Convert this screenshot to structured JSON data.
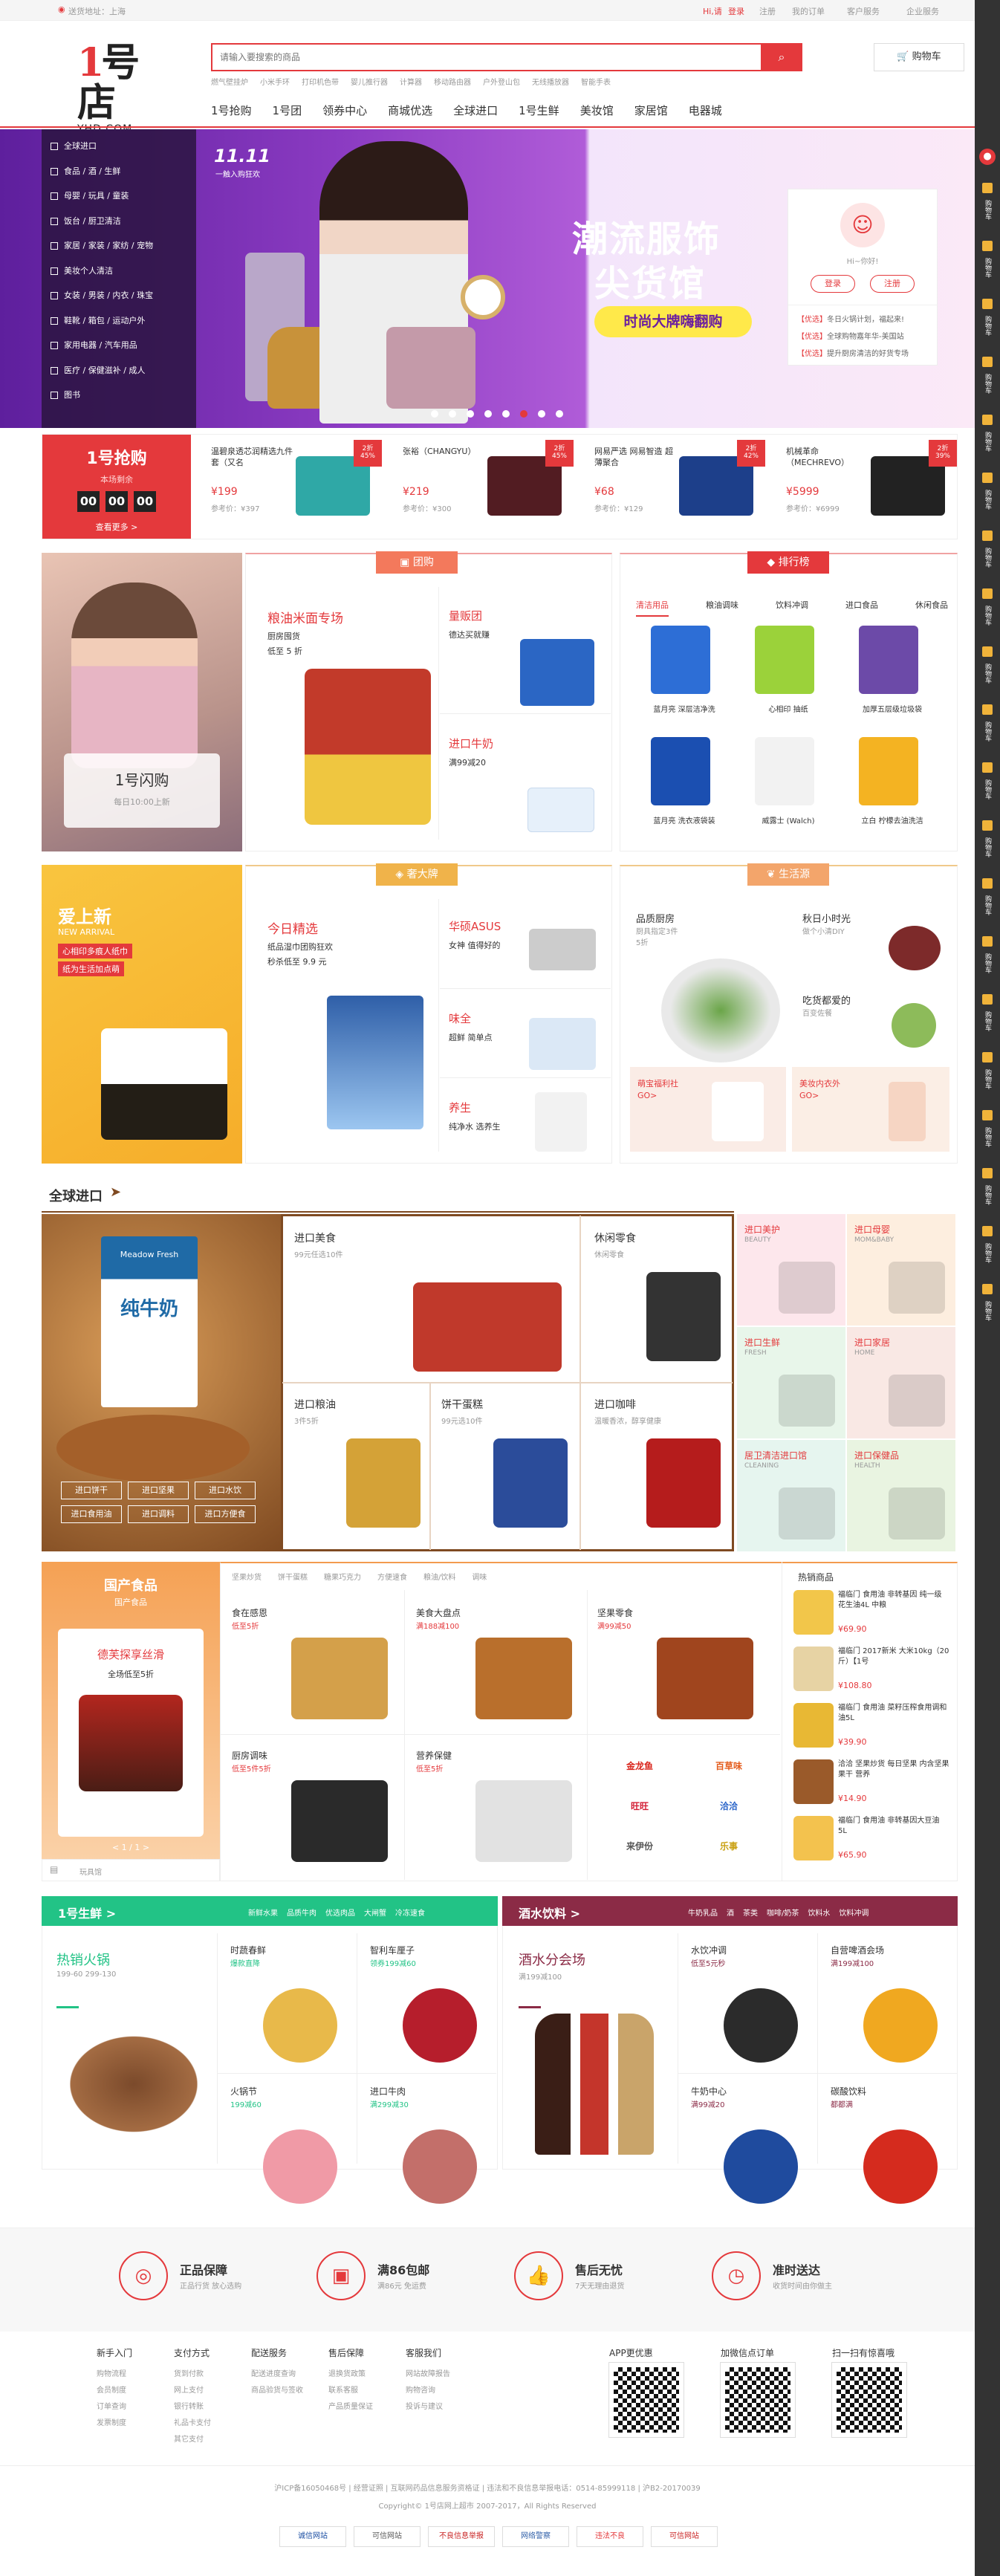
{
  "topbar": {
    "location": "送货地址：上海",
    "greeting": "Hi,请",
    "login": "登录",
    "register": "注册",
    "my_orders": "我的订单",
    "customer_service": "客户服务",
    "enterprise": "企业服务"
  },
  "logo": {
    "sub": "YHD.COM"
  },
  "search": {
    "placeholder": "请输入要搜索的商品",
    "hot": [
      "燃气壁挂炉",
      "小米手环",
      "打印机色带",
      "婴儿推行器",
      "计算器",
      "移动路由器",
      "户外登山包",
      "无线播放器",
      "智能手表"
    ],
    "cart": "购物车"
  },
  "nav": [
    "1号抢购",
    "1号团",
    "领券中心",
    "商城优选",
    "全球进口",
    "1号生鲜",
    "美妆馆",
    "家居馆",
    "电器城"
  ],
  "categories": [
    "全球进口",
    "食品 / 酒 / 生鲜",
    "母婴 / 玩具 / 童装",
    "饭台 / 厨卫清洁",
    "家居 / 家装 / 家纺 / 宠物",
    "美妆个人清洁",
    "女装 / 男装 / 内衣 / 珠宝",
    "鞋靴 / 箱包 / 运动户外",
    "家用电器 / 汽车用品",
    "医疗 / 保健滋补 / 成人",
    "图书"
  ],
  "banner": {
    "badge": "11.11",
    "badge_sub": "一触入购狂欢",
    "title1": "潮流服饰",
    "title2": "尖货馆",
    "cta": "时尚大牌嗨翻购"
  },
  "userbox": {
    "hello": "Hi~你好!",
    "login": "登录",
    "register": "注册",
    "news": [
      {
        "tag": "【优选】",
        "text": "冬日火锅计划，福起来!"
      },
      {
        "tag": "【优选】",
        "text": "全球购物嘉年华-美国站"
      },
      {
        "tag": "【优选】",
        "text": "提升厨房清洁的好货专场"
      }
    ]
  },
  "flash": {
    "title": "1号抢购",
    "subtitle": "本场剩余",
    "h": "00",
    "m": "00",
    "s": "00",
    "more": "查看更多 >",
    "items": [
      {
        "name": "温碧泉透芯润精选九件套（又名",
        "price": "¥199",
        "ref": "参考价：¥397",
        "badge": "2折",
        "discount": "45%"
      },
      {
        "name": "张裕（CHANGYU）",
        "price": "¥219",
        "ref": "参考价：¥300",
        "badge": "2折",
        "discount": "45%"
      },
      {
        "name": "网易严选 网易智造 超薄聚合",
        "price": "¥68",
        "ref": "参考价：¥129",
        "badge": "2折",
        "discount": "42%"
      },
      {
        "name": "机械革命（MECHREVO）",
        "price": "¥5999",
        "ref": "参考价：¥6999",
        "badge": "2折",
        "discount": "39%"
      }
    ]
  },
  "tuan": {
    "tab": "团购",
    "flash_title": "1号闪购",
    "flash_sub": "每日10:00上新",
    "main_title": "粮油米面专场",
    "main_sub1": "厨房囤货",
    "main_sub2": "低至 5 折",
    "a_title": "量贩团",
    "a_sub": "德达买就赚",
    "b_title": "进口牛奶",
    "b_sub": "满99减20"
  },
  "rank": {
    "tab": "排行榜",
    "tabs": [
      "清洁用品",
      "粮油调味",
      "饮料冲调",
      "进口食品",
      "休闲食品"
    ],
    "items": [
      "蓝月亮 深层洁净洗",
      "心相印 抽纸",
      "加厚五层级垃圾袋",
      "蓝月亮 洗衣液袋装",
      "威露士 (Walch)",
      "立白 柠檬去油洗洁"
    ]
  },
  "brand": {
    "new_title": "爱上新",
    "new_en": "NEW ARRIVAL",
    "new_l1": "心相印多痕人纸巾",
    "new_l2": "纸为生活加点萌",
    "tab": "奢大牌",
    "today_title": "今日精选",
    "today_l1": "纸品湿巾团购狂欢",
    "today_l2": "秒杀低至 9.9 元",
    "a_title": "华硕ASUS",
    "a_sub": "女神 值得好的",
    "b_title": "味全",
    "b_sub": "超鲜 简单点",
    "c_title": "养生",
    "c_sub": "纯净水 选养生"
  },
  "life": {
    "tab": "生活源",
    "a_title": "品质厨房",
    "a_l1": "厨具指定3件",
    "a_l2": "5折",
    "b_title": "秋日小时光",
    "b_l1": "做个小清DIY",
    "c_title": "吃货都爱的",
    "c_l1": "百变佐餐",
    "d_title": "萌宝福利社",
    "d_l1": "GO>",
    "e_title": "美妆内衣外",
    "e_l1": "GO>"
  },
  "global": {
    "title": "全球进口",
    "milk_brand": "Meadow Fresh",
    "milk_text": "纯牛奶",
    "buttons": [
      "进口饼干",
      "进口坚果",
      "进口水饮",
      "进口食用油",
      "进口调料",
      "进口方便食"
    ],
    "cells": [
      {
        "title": "进口美食",
        "sub": "99元任选10件"
      },
      {
        "title": "休闲零食",
        "sub": "休闲零食"
      },
      {
        "title": "进口粮油",
        "sub": "3件5折"
      },
      {
        "title": "饼干蛋糕",
        "sub": "99元选10件"
      },
      {
        "title": "进口咖啡",
        "sub": "温暖香浓，醇享健康"
      }
    ],
    "side": [
      {
        "title": "进口美护",
        "en": "BEAUTY"
      },
      {
        "title": "进口母婴",
        "en": "MOM&BABY"
      },
      {
        "title": "进口生鲜",
        "en": "FRESH"
      },
      {
        "title": "进口家居",
        "en": "HOME"
      },
      {
        "title": "居卫清洁进口馆",
        "en": "CLEANING"
      },
      {
        "title": "进口保健品",
        "en": "HEALTH"
      }
    ]
  },
  "domestic": {
    "title": "国产食品",
    "subtitle": "国产食品",
    "promo_title": "德芙探享丝滑",
    "promo_sub": "全场低至5折",
    "pager": "< 1 / 1 >",
    "footer": "玩具馆",
    "tabs": [
      "坚果炒货",
      "饼干蛋糕",
      "糖果巧克力",
      "方便速食",
      "粮油/饮料",
      "调味"
    ],
    "cells": [
      {
        "title": "食在感恩",
        "sub": "低至5折"
      },
      {
        "title": "美食大盘点",
        "sub": "满188减100"
      },
      {
        "title": "坚果零食",
        "sub": "满99减50"
      },
      {
        "title": "厨房调味",
        "sub": "低至5件5折"
      },
      {
        "title": "营养保健",
        "sub": "低至5折"
      }
    ],
    "brands": [
      "金龙鱼",
      "百草味",
      "旺旺",
      "洽洽",
      "来伊份",
      "乐事"
    ],
    "hot_title": "热销商品",
    "hot": [
      {
        "name": "福临门 食用油 非转基因 纯一级 花生油4L 中粮",
        "price": "¥69.90"
      },
      {
        "name": "福临门 2017新米 大米10kg（20斤）【1号",
        "price": "¥108.80"
      },
      {
        "name": "福临门 食用油 菜籽压榨食用调和油5L",
        "price": "¥39.90"
      },
      {
        "name": "洽洽 坚果炒货 每日坚果 内含坚果果干 营养",
        "price": "¥14.90"
      },
      {
        "name": "福临门 食用油 非转基因大豆油 5L",
        "price": "¥65.90"
      }
    ]
  },
  "fresh": {
    "title": "1号生鲜 >",
    "tabs": [
      "新鲜水果",
      "品质牛肉",
      "优选肉品",
      "大闸蟹",
      "冷冻速食"
    ],
    "main_title": "热销火锅",
    "main_sub": "199-60 299-130",
    "cells": [
      {
        "title": "时蔬春鲜",
        "sub": "爆款直降"
      },
      {
        "title": "智利车厘子",
        "sub": "领券199减60"
      },
      {
        "title": "火锅节",
        "sub": "199减60"
      },
      {
        "title": "进口牛肉",
        "sub": "满299减30"
      }
    ]
  },
  "drinks": {
    "title": "酒水饮料 >",
    "tabs": [
      "牛奶乳品",
      "酒",
      "茶类",
      "咖啡/奶茶",
      "饮料水",
      "饮料冲调"
    ],
    "main_title": "酒水分会场",
    "main_sub": "满199减100",
    "cells": [
      {
        "title": "水饮冲调",
        "sub": "低至5元秒"
      },
      {
        "title": "自营啤酒会场",
        "sub": "满199减100"
      },
      {
        "title": "牛奶中心",
        "sub": "满99减20"
      },
      {
        "title": "碳酸饮料",
        "sub": "都都满"
      }
    ]
  },
  "service": [
    {
      "title": "正品保障",
      "sub": "正品行货 放心选购"
    },
    {
      "title": "满86包邮",
      "sub": "满86元 免运费"
    },
    {
      "title": "售后无忧",
      "sub": "7天无理由退货"
    },
    {
      "title": "准时送达",
      "sub": "收货时间由你做主"
    }
  ],
  "footer_cols": [
    {
      "title": "新手入门",
      "items": [
        "购物流程",
        "会员制度",
        "订单查询",
        "发票制度"
      ]
    },
    {
      "title": "支付方式",
      "items": [
        "货到付款",
        "网上支付",
        "银行转账",
        "礼品卡支付",
        "其它支付"
      ]
    },
    {
      "title": "配送服务",
      "items": [
        "配送进度查询",
        "商品验货与签收"
      ]
    },
    {
      "title": "售后保障",
      "items": [
        "退换货政策",
        "联系客服",
        "产品质量保证"
      ]
    },
    {
      "title": "客服我们",
      "items": [
        "网站故障报告",
        "购物咨询",
        "投诉与建议"
      ]
    }
  ],
  "qr": [
    "APP更优惠",
    "加微信点订单",
    "扫一扫有惊喜哦"
  ],
  "copyright1": "沪ICP备16050468号 | 经营证照 | 互联网药品信息服务资格证 | 违法和不良信息举报电话：0514-85999118 | 沪B2-20170039",
  "copyright2": "Copyright© 1号店网上超市 2007-2017，All Rights Reserved",
  "badges": [
    "诚信网站",
    "可信网站",
    "不良信息举报",
    "网络警察",
    "违法不良",
    "可信网站"
  ],
  "sidebar": [
    "购物车",
    "购物车",
    "购物车",
    "购物车",
    "购物车",
    "购物车",
    "购物车",
    "购物车",
    "购物车",
    "购物车",
    "购物车",
    "购物车",
    "购物车",
    "购物车",
    "购物车",
    "购物车",
    "购物车",
    "购物车",
    "购物车",
    "购物车"
  ],
  "colors": {
    "brand": "#e4393c",
    "fresh": "#22c386",
    "drinks": "#8b2b46",
    "domestic": "#f39b4e",
    "global": "#7f4a21",
    "banner_bg": "#7a2fb4",
    "flash_bg": "#e4393c"
  }
}
